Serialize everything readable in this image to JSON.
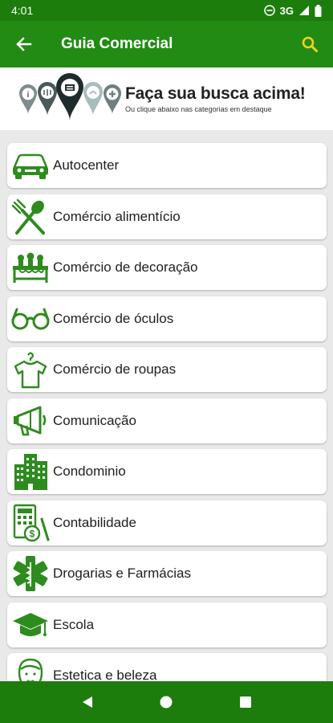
{
  "status": {
    "time": "4:01",
    "network": "3G",
    "icons": [
      "dnd-icon",
      "signal-icon",
      "battery-icon"
    ]
  },
  "header": {
    "title": "Guia Comercial",
    "back_icon": "arrow-left-icon",
    "search_icon": "search-icon"
  },
  "banner": {
    "headline": "Faça sua busca acima!",
    "subline": "Ou clique abaixo nas categorias em destaque"
  },
  "categories": [
    {
      "label": "Autocenter",
      "icon": "car-icon"
    },
    {
      "label": "Comércio alimentício",
      "icon": "fork-spoon-icon"
    },
    {
      "label": "Comércio de decoração",
      "icon": "decor-table-icon"
    },
    {
      "label": "Comércio de óculos",
      "icon": "glasses-icon"
    },
    {
      "label": "Comércio de roupas",
      "icon": "shirt-hanger-icon"
    },
    {
      "label": "Comunicação",
      "icon": "megaphone-icon"
    },
    {
      "label": "Condominio",
      "icon": "buildings-icon"
    },
    {
      "label": "Contabilidade",
      "icon": "accounting-icon"
    },
    {
      "label": "Drogarias e Farmácias",
      "icon": "pharmacy-icon"
    },
    {
      "label": "Escola",
      "icon": "graduation-cap-icon"
    },
    {
      "label": "Estetica e beleza",
      "icon": "beauty-icon"
    }
  ],
  "colors": {
    "status_bar": "#1c7d0c",
    "app_bar": "#228b14",
    "accent_search": "#f2d21b",
    "icon_green": "#2e8b1e",
    "background": "#e9e9e9"
  },
  "navigation": [
    "back-triangle-icon",
    "home-circle-icon",
    "recents-square-icon"
  ]
}
